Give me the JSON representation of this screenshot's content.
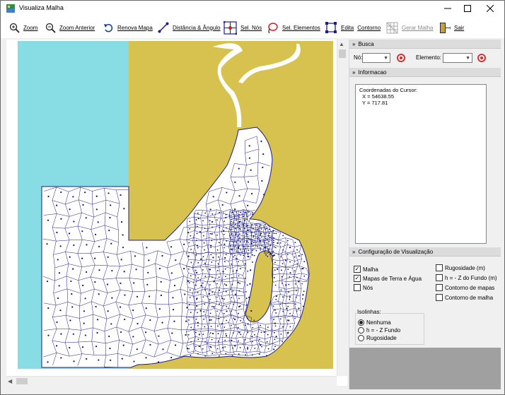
{
  "window": {
    "title": "Visualiza Malha"
  },
  "toolbar": {
    "zoom": "Zoom",
    "zoom_previous": "Zoom Anterior",
    "refresh_map": "Renova Mapa",
    "distance_angle": "Distância & Ângulo",
    "select_nodes": "Sel. Nós",
    "select_elements": "Sel. Elementos",
    "edit": "Edita",
    "contour": "Contorno",
    "generate_mesh": "Gerar Malha",
    "exit": "Sair"
  },
  "panel": {
    "search": {
      "header": "Busca",
      "node_label": "Nó:",
      "node_value": "",
      "element_label": "Elemento:",
      "element_value": ""
    },
    "info": {
      "header": "Informacao",
      "text": "Coordenadas do Cursor:\n  X = 54638.55\n  Y = 717.81"
    },
    "config": {
      "header": "Configuração de Visualização",
      "checkboxes": [
        {
          "label": "Malha",
          "checked": true
        },
        {
          "label": "Mapas de Terra e Água",
          "checked": true
        },
        {
          "label": "Nós",
          "checked": false
        },
        {
          "label": "Rugosidade (m)",
          "checked": false
        },
        {
          "label": "h = - Z do Fundo (m)",
          "checked": false
        },
        {
          "label": "Contorno de mapas",
          "checked": false
        },
        {
          "label": "Contorno de malha",
          "checked": false
        }
      ],
      "isolines_title": "Isolinhas:",
      "isolines": [
        {
          "label": "Nenhuma",
          "selected": true
        },
        {
          "label": "h = - Z Fundo",
          "selected": false
        },
        {
          "label": "Rugosidade",
          "selected": false
        }
      ]
    }
  },
  "colors": {
    "water": "#87dde3",
    "land": "#d8c24f",
    "mesh": "#1c1c8a",
    "node": "#101070"
  }
}
